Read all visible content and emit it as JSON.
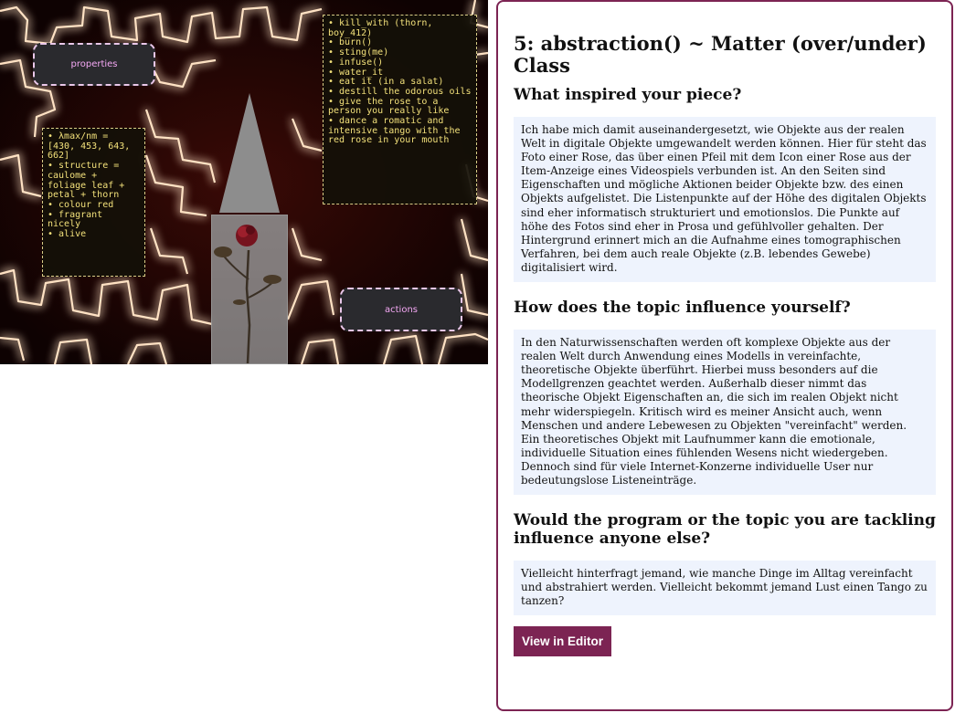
{
  "artwork": {
    "properties_label": "properties",
    "actions_label": "actions",
    "properties_items": [
      "• λmax/nm = [430, 453, 643, 662]",
      "• structure = caulome + foliage leaf + petal + thorn",
      "• colour red",
      "• fragrant nicely",
      "• alive"
    ],
    "actions_items": [
      "• kill_with (thorn, boy_412)",
      "• burn()",
      "• sting(me)",
      "• infuse()",
      "• water_it",
      "• eat it (in a salat)",
      "• destill the odorous oils",
      "• give the rose to a person you really like",
      "• dance a romatic and intensive tango with the red rose in your mouth"
    ],
    "colors": {
      "glow": "#ffd9b3",
      "background": "#150303",
      "label_text": "#f4a8f4",
      "code_text": "#f2e07a"
    }
  },
  "panel": {
    "title": "5: abstraction() ~ Matter (over/under) Class",
    "sections": [
      {
        "question": "What inspired your piece?",
        "answer": "Ich habe mich damit auseinandergesetzt, wie Objekte aus der realen Welt in digitale Objekte umgewandelt werden können. Hier für steht das Foto einer Rose, das über einen Pfeil mit dem Icon einer Rose aus der Item-Anzeige eines Videospiels verbunden ist. An den Seiten sind Eigenschaften und mögliche Aktionen beider Objekte bzw. des einen Objekts aufgelistet. Die Listenpunkte auf der Höhe des digitalen Objekts sind eher informatisch strukturiert und emotionslos. Die Punkte auf höhe des Fotos sind eher in Prosa und gefühlvoller gehalten. Der Hintergrund erinnert mich an die Aufnahme eines tomographischen Verfahren, bei dem auch reale Objekte (z.B. lebendes Gewebe) digitalisiert wird."
      },
      {
        "question": "How does the topic influence yourself?",
        "answer": "In den Naturwissenschaften werden oft komplexe Objekte aus der realen Welt durch Anwendung eines Modells in vereinfachte, theoretische Objekte überführt. Hierbei muss besonders auf die Modellgrenzen geachtet werden. Außerhalb dieser nimmt das theorische Objekt Eigenschaften an, die sich im realen Objekt nicht mehr widerspiegeln. Kritisch wird es meiner Ansicht auch, wenn Menschen und andere Lebewesen zu Objekten \"vereinfacht\" werden. Ein theoretisches Objekt mit Laufnummer kann die emotionale, individuelle Situation eines fühlenden Wesens nicht wiedergeben. Dennoch sind für viele Internet-Konzerne individuelle User nur bedeutungslose Listeneinträge."
      },
      {
        "question": "Would the program or the topic you are tackling influence anyone else?",
        "answer": "Vielleicht hinterfragt jemand, wie manche Dinge im Alltag vereinfacht und abstrahiert werden. Vielleicht bekommt jemand Lust einen Tango zu tanzen?"
      }
    ],
    "button_label": "View in Editor",
    "accent_color": "#7c2453",
    "answer_bg": "#eef3fd"
  }
}
